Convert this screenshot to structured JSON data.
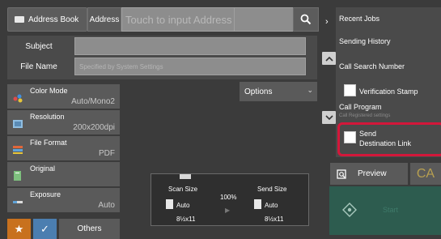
{
  "toolbar": {
    "address_book": "Address Book",
    "address_label": "Address",
    "address_placeholder": "Touch to input Address"
  },
  "fields": {
    "subject_label": "Subject",
    "subject_value": "",
    "filename_label": "File Name",
    "filename_placeholder": "Specified by System Settings"
  },
  "settings": [
    {
      "label": "Color Mode",
      "value": "Auto/Mono2",
      "icon": "color-mode-icon"
    },
    {
      "label": "Resolution",
      "value": "200x200dpi",
      "icon": "resolution-icon"
    },
    {
      "label": "File Format",
      "value": "PDF",
      "icon": "file-format-icon"
    },
    {
      "label": "Original",
      "value": "",
      "icon": "original-icon"
    },
    {
      "label": "Exposure",
      "value": "Auto",
      "icon": "exposure-icon"
    }
  ],
  "options_label": "Options",
  "preview": {
    "scan_size_label": "Scan Size",
    "scan_size_value": "Auto",
    "scan_paper": "8½x11",
    "ratio": "100%",
    "send_size_label": "Send Size",
    "send_size_value": "Auto",
    "send_paper": "8½x11"
  },
  "right_panel": {
    "items": [
      "Recent Jobs",
      "Sending History",
      "Call Search Number",
      "Verification Stamp",
      "Call Program",
      "Call Registered settings",
      "Send",
      "Destination Link"
    ]
  },
  "preview_button": "Preview",
  "ca_button": "CA",
  "start_button": "Start",
  "others_button": "Others",
  "colors": {
    "highlight": "#d3173a",
    "start": "#2d5c4f",
    "star": "#c8711e",
    "check": "#4b7eb0"
  }
}
